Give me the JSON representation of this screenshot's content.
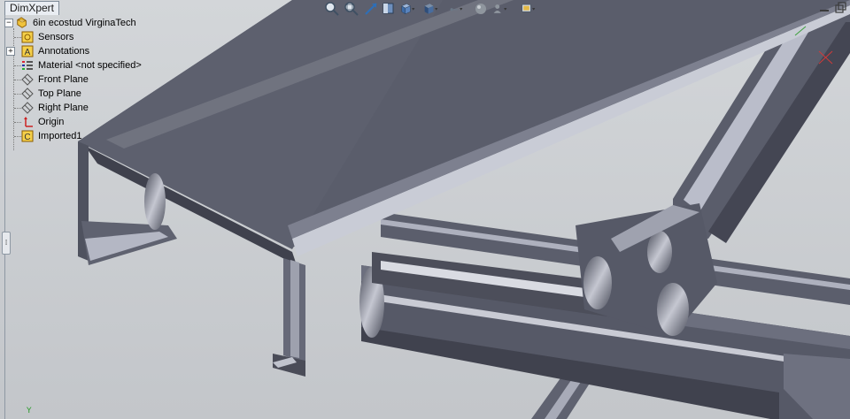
{
  "tabs": {
    "dimxpert": "DimXpert"
  },
  "tree": {
    "root": "6in ecostud VirginaTech",
    "items": [
      {
        "label": "Sensors",
        "icon": "sensor-icon"
      },
      {
        "label": "Annotations",
        "icon": "annotation-icon"
      },
      {
        "label": "Material <not specified>",
        "icon": "material-icon"
      },
      {
        "label": "Front Plane",
        "icon": "plane-icon"
      },
      {
        "label": "Top Plane",
        "icon": "plane-icon"
      },
      {
        "label": "Right Plane",
        "icon": "plane-icon"
      },
      {
        "label": "Origin",
        "icon": "origin-icon"
      },
      {
        "label": "Imported1",
        "icon": "imported-body-icon"
      }
    ]
  },
  "triad": {
    "y_label": "Y"
  },
  "colors": {
    "background": "#c6cace",
    "steel": "#5c5f6e",
    "steel_dark": "#3e404c",
    "steel_light": "#9a9dab"
  }
}
